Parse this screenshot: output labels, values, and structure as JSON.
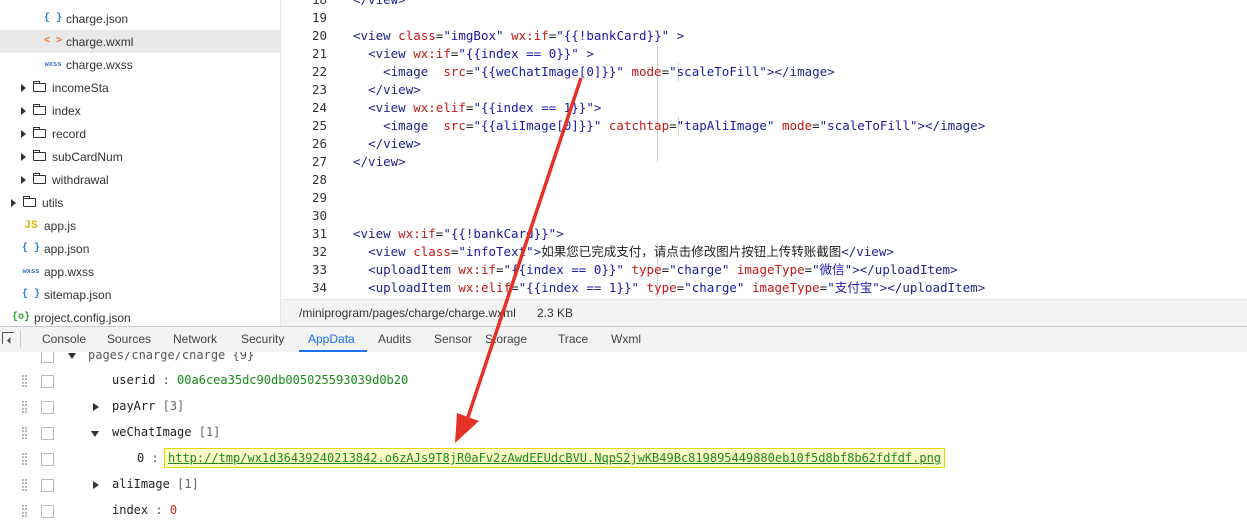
{
  "sidebar": {
    "items": [
      {
        "label": "charge.json",
        "icon": "{ }",
        "type": "json"
      },
      {
        "label": "charge.wxml",
        "icon": "< >",
        "type": "wxml"
      },
      {
        "label": "charge.wxss",
        "icon": "wxss",
        "type": "wxss"
      },
      {
        "label": "incomeSta",
        "type": "folder"
      },
      {
        "label": "index",
        "type": "folder"
      },
      {
        "label": "record",
        "type": "folder"
      },
      {
        "label": "subCardNum",
        "type": "folder"
      },
      {
        "label": "withdrawal",
        "type": "folder"
      },
      {
        "label": "utils",
        "type": "folder"
      },
      {
        "label": "app.js",
        "icon": "JS",
        "type": "js"
      },
      {
        "label": "app.json",
        "icon": "{ }",
        "type": "json"
      },
      {
        "label": "app.wxss",
        "icon": "wxss",
        "type": "wxss"
      },
      {
        "label": "sitemap.json",
        "icon": "{ }",
        "type": "json"
      },
      {
        "label": "project.config.json",
        "icon": "{o}",
        "type": "cfg"
      }
    ]
  },
  "editor": {
    "lines": [
      {
        "num": "18",
        "text": "</view>"
      },
      {
        "num": "19",
        "text": ""
      },
      {
        "num": "20",
        "text": "<view class=\"imgBox\" wx:if=\"{{!bankCard}}\" >"
      },
      {
        "num": "21",
        "text": "  <view wx:if=\"{{index == 0}}\" >"
      },
      {
        "num": "22",
        "text": "    <image  src=\"{{weChatImage[0]}}\" mode=\"scaleToFill\"></image>"
      },
      {
        "num": "23",
        "text": "  </view>"
      },
      {
        "num": "24",
        "text": "  <view wx:elif=\"{{index == 1}}\">"
      },
      {
        "num": "25",
        "text": "    <image  src=\"{{aliImage[0]}}\" catchtap=\"tapAliImage\" mode=\"scaleToFill\"></image>"
      },
      {
        "num": "26",
        "text": "  </view>"
      },
      {
        "num": "27",
        "text": "</view>"
      },
      {
        "num": "28",
        "text": ""
      },
      {
        "num": "29",
        "text": ""
      },
      {
        "num": "30",
        "text": ""
      },
      {
        "num": "31",
        "text": "<view wx:if=\"{{!bankCard}}\">"
      },
      {
        "num": "32",
        "text": "  <view class=\"infoText\">如果您已完成支付，请点击修改图片按钮上传转账截图</view>"
      },
      {
        "num": "33",
        "text": "  <uploadItem wx:if=\"{{index == 0}}\" type=\"charge\" imageType=\"微信\"></uploadItem>"
      },
      {
        "num": "34",
        "text": "  <uploadItem wx:elif=\"{{index == 1}}\" type=\"charge\" imageType=\"支付宝\"></uploadItem>"
      }
    ]
  },
  "statusbar": {
    "path": "/miniprogram/pages/charge/charge.wxml",
    "size": "2.3 KB"
  },
  "devtools": {
    "tabs": [
      "Console",
      "Sources",
      "Network",
      "Security",
      "AppData",
      "Audits",
      "Sensor",
      "Storage",
      "Trace",
      "Wxml"
    ],
    "active_tab": "AppData"
  },
  "appdata": {
    "root": "pages/charge/charge {9}",
    "userid_key": "userid",
    "userid_val": "00a6cea35dc90db005025593039d0b20",
    "payArr_key": "payArr",
    "payArr_count": "[3]",
    "weChatImage_key": "weChatImage",
    "weChatImage_count": "[1]",
    "item0_index": "0",
    "item0_url": "http://tmp/wx1d36439240213842.o6zAJs9T8jR0aFv2zAwdEEUdcBVU.NqpS2jwKB49Bc819895449880eb10f5d8bf8b62fdfdf.png",
    "aliImage_key": "aliImage",
    "aliImage_count": "[1]",
    "index_key": "index",
    "index_val": "0"
  },
  "colors": {
    "accent": "#1a73e8",
    "arrow": "#e53226",
    "highlight": "#fdfbc8"
  }
}
